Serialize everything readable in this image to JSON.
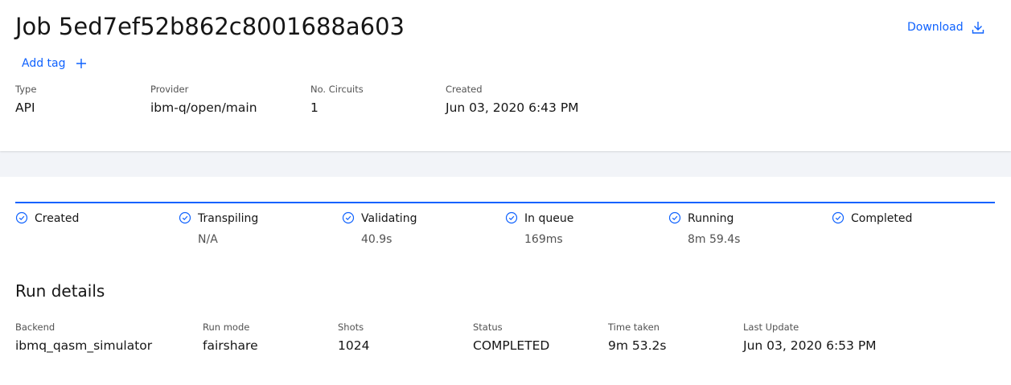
{
  "header": {
    "title": "Job 5ed7ef52b862c8001688a603",
    "download_label": "Download",
    "add_tag_label": "Add tag"
  },
  "meta": [
    {
      "label": "Type",
      "value": "API"
    },
    {
      "label": "Provider",
      "value": "ibm-q/open/main"
    },
    {
      "label": "No. Circuits",
      "value": "1"
    },
    {
      "label": "Created",
      "value": "Jun 03, 2020 6:43 PM"
    }
  ],
  "steps": [
    {
      "label": "Created",
      "sub": ""
    },
    {
      "label": "Transpiling",
      "sub": "N/A"
    },
    {
      "label": "Validating",
      "sub": "40.9s"
    },
    {
      "label": "In queue",
      "sub": "169ms"
    },
    {
      "label": "Running",
      "sub": "8m 59.4s"
    },
    {
      "label": "Completed",
      "sub": ""
    }
  ],
  "run_details": {
    "title": "Run details",
    "fields": [
      {
        "label": "Backend",
        "value": "ibmq_qasm_simulator"
      },
      {
        "label": "Run mode",
        "value": "fairshare"
      },
      {
        "label": "Shots",
        "value": "1024"
      },
      {
        "label": "Status",
        "value": "COMPLETED"
      },
      {
        "label": "Time taken",
        "value": "9m 53.2s"
      },
      {
        "label": "Last Update",
        "value": "Jun 03, 2020 6:53 PM"
      }
    ]
  },
  "colors": {
    "accent": "#0f62fe",
    "text": "#161616",
    "secondary_text": "#525252",
    "band": "#f2f4f8"
  },
  "icons": {
    "download": "download-icon",
    "add": "plus-icon",
    "step": "checkmark-outline-icon"
  }
}
